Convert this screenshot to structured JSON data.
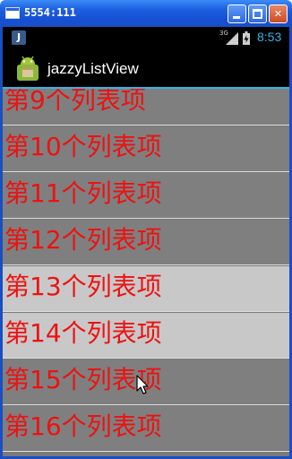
{
  "window": {
    "title": "5554:111",
    "minimize_label": "_",
    "maximize_label": "□",
    "close_label": "✕"
  },
  "status_bar": {
    "notification_label": "J",
    "network": "3G",
    "time": "8:53"
  },
  "action_bar": {
    "app_title": "jazzyListView"
  },
  "list": {
    "items": [
      {
        "label": "第9个列表项"
      },
      {
        "label": "第10个列表项"
      },
      {
        "label": "第11个列表项"
      },
      {
        "label": "第12个列表项"
      },
      {
        "label": "第13个列表项"
      },
      {
        "label": "第14个列表项"
      },
      {
        "label": "第15个列表项"
      },
      {
        "label": "第16个列表项"
      }
    ]
  },
  "colors": {
    "item_text": "#ee1111",
    "item_dark_bg": "#7f7f7f",
    "item_light_bg": "#c8c8c8",
    "accent": "#33b5e5",
    "window_chrome": "#1d5fe0"
  }
}
